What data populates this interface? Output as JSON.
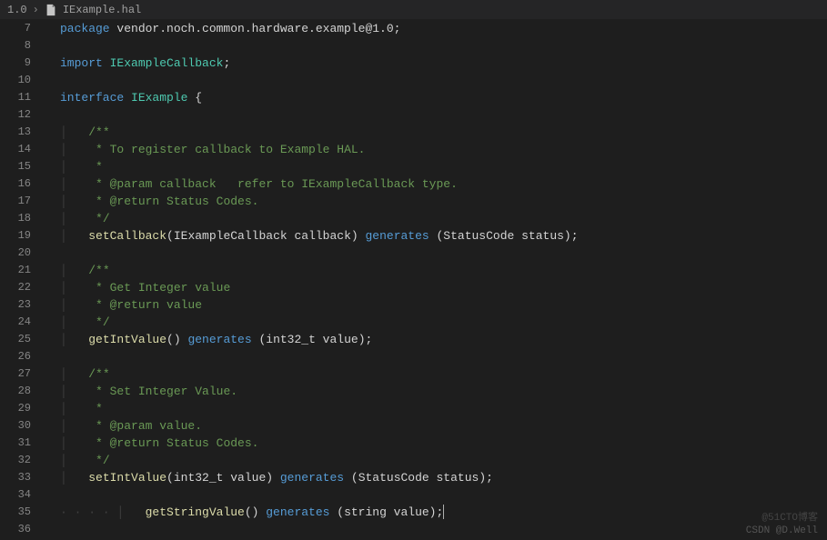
{
  "breadcrumb": {
    "version": "1.0",
    "filename": "IExample.hal"
  },
  "lines": {
    "start": 7,
    "end": 36
  },
  "code": {
    "l7": {
      "kw": "package",
      "pkg": " vendor.noch.common.hardware.example@1.0",
      "end": ";"
    },
    "l9": {
      "kw": "import",
      "name": " IExampleCallback",
      "end": ";"
    },
    "l11": {
      "kw": "interface",
      "name": " IExample ",
      "brace": "{"
    },
    "l13": "/**",
    "l14": " * To register callback to Example HAL.",
    "l15": " *",
    "l16": " * @param callback   refer to IExampleCallback type.",
    "l17": " * @return Status Codes.",
    "l18": " */",
    "l19": {
      "fn": "setCallback",
      "sig": "(IExampleCallback callback) ",
      "gen": "generates",
      "ret": " (StatusCode status);"
    },
    "l21": "/**",
    "l22": " * Get Integer value",
    "l23": " * @return value",
    "l24": " */",
    "l25": {
      "fn": "getIntValue",
      "sig": "() ",
      "gen": "generates",
      "ret": " (int32_t value);"
    },
    "l27": "/**",
    "l28": " * Set Integer Value.",
    "l29": " *",
    "l30": " * @param value.",
    "l31": " * @return Status Codes.",
    "l32": " */",
    "l33": {
      "fn": "setIntValue",
      "sig": "(int32_t value) ",
      "gen": "generates",
      "ret": " (StatusCode status);"
    },
    "l35": {
      "fn": "getStringValue",
      "sig": "() ",
      "gen": "generates",
      "ret": " (string value);"
    }
  },
  "watermarks": {
    "top": "@51CTO博客",
    "bottom": "CSDN @D.Well"
  }
}
